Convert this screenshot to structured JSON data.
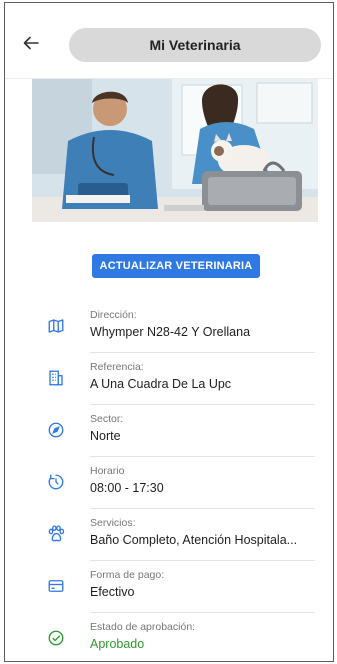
{
  "header": {
    "title": "Mi Veterinaria"
  },
  "actions": {
    "update_label": "ACTUALIZAR VETERINARIA"
  },
  "colors": {
    "primary": "#2f79e3",
    "icon": "#2f79e3",
    "approved": "#2e9b2e"
  },
  "details": [
    {
      "icon": "map-icon",
      "label": "Dirección:",
      "value": "Whymper N28-42 Y Orellana"
    },
    {
      "icon": "building-icon",
      "label": "Referencia:",
      "value": "A Una Cuadra De La Upc"
    },
    {
      "icon": "compass-icon",
      "label": "Sector:",
      "value": "Norte"
    },
    {
      "icon": "clock-icon",
      "label": "Horario",
      "value": "08:00 - 17:30"
    },
    {
      "icon": "paw-icon",
      "label": "Servicios:",
      "value": "Baño Completo, Atención Hospitala..."
    },
    {
      "icon": "credit-card-icon",
      "label": "Forma de pago:",
      "value": "Efectivo"
    },
    {
      "icon": "check-circle-icon",
      "label": "Estado de aprobación:",
      "value": "Aprobado"
    }
  ]
}
